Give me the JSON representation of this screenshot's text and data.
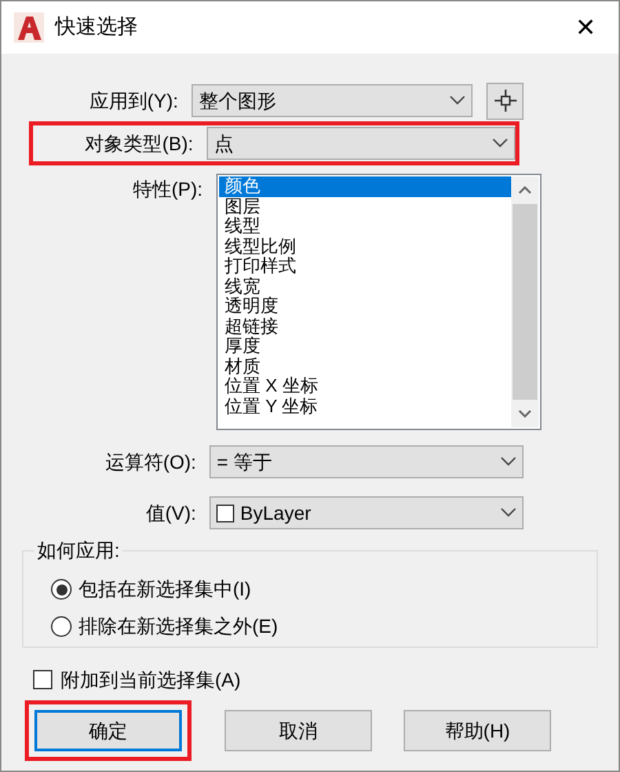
{
  "window": {
    "title": "快速选择",
    "close": "✕"
  },
  "apply_to": {
    "label": "应用到(Y):",
    "value": "整个图形",
    "highlighted": false
  },
  "object_type": {
    "label": "对象类型(B):",
    "value": "点",
    "highlighted": true
  },
  "properties": {
    "label": "特性(P):",
    "items": [
      {
        "text": "颜色",
        "selected": true
      },
      {
        "text": "图层",
        "selected": false
      },
      {
        "text": "线型",
        "selected": false
      },
      {
        "text": "线型比例",
        "selected": false
      },
      {
        "text": "打印样式",
        "selected": false
      },
      {
        "text": "线宽",
        "selected": false
      },
      {
        "text": "透明度",
        "selected": false
      },
      {
        "text": "超链接",
        "selected": false
      },
      {
        "text": "厚度",
        "selected": false
      },
      {
        "text": "材质",
        "selected": false
      },
      {
        "text": "位置 X 坐标",
        "selected": false
      },
      {
        "text": "位置 Y 坐标",
        "selected": false
      }
    ]
  },
  "operator": {
    "label": "运算符(O):",
    "value": "= 等于"
  },
  "value": {
    "label": "值(V):",
    "value": "ByLayer",
    "color": "#ffffff"
  },
  "how_to_apply": {
    "label": "如何应用:",
    "options": [
      {
        "text": "包括在新选择集中(I)",
        "selected": true
      },
      {
        "text": "排除在新选择集之外(E)",
        "selected": false
      }
    ]
  },
  "append": {
    "text": "附加到当前选择集(A)",
    "checked": false
  },
  "buttons": [
    {
      "text": "确定",
      "default": true,
      "highlighted": true
    },
    {
      "text": "取消",
      "default": false,
      "highlighted": false
    },
    {
      "text": "帮助(H)",
      "default": false,
      "highlighted": false
    }
  ]
}
